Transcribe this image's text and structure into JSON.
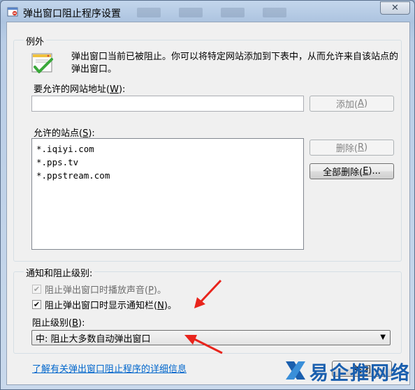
{
  "window": {
    "title": "弹出窗口阻止程序设置",
    "close_glyph": "✕"
  },
  "exceptions": {
    "group_label": "例外",
    "description": "弹出窗口当前已被阻止。你可以将特定网站添加到下表中，从而允许来自该站点的弹出窗口。",
    "address_label_prefix": "要允许的网站地址(",
    "address_label_key": "W",
    "address_label_suffix": "):",
    "address_value": "",
    "add_button_prefix": "添加(",
    "add_button_key": "A",
    "add_button_suffix": ")",
    "allowed_label_prefix": "允许的站点(",
    "allowed_label_key": "S",
    "allowed_label_suffix": "):",
    "allowed_sites": [
      "*.iqiyi.com",
      "*.pps.tv",
      "*.ppstream.com"
    ],
    "remove_button_prefix": "删除(",
    "remove_button_key": "R",
    "remove_button_suffix": ")",
    "remove_all_prefix": "全部删除(",
    "remove_all_key": "E",
    "remove_all_suffix": ")..."
  },
  "notifications": {
    "group_label": "通知和阻止级别:",
    "play_sound_prefix": "阻止弹出窗口时播放声音(",
    "play_sound_key": "P",
    "play_sound_suffix": ")。",
    "play_sound_checked": true,
    "play_sound_enabled": false,
    "show_bar_prefix": "阻止弹出窗口时显示通知栏(",
    "show_bar_key": "N",
    "show_bar_suffix": ")。",
    "show_bar_checked": true,
    "level_label_prefix": "阻止级别(",
    "level_label_key": "B",
    "level_label_suffix": "):",
    "level_value": "中: 阻止大多数自动弹出窗口"
  },
  "footer": {
    "learn_more_link": "了解有关弹出窗口阻止程序的详细信息",
    "close_button": "关闭",
    "watermark_text": "易企推网络"
  },
  "colors": {
    "link": "#0066cc",
    "annotation_arrow": "#e8241c",
    "titlebar": "#adc4e0"
  }
}
